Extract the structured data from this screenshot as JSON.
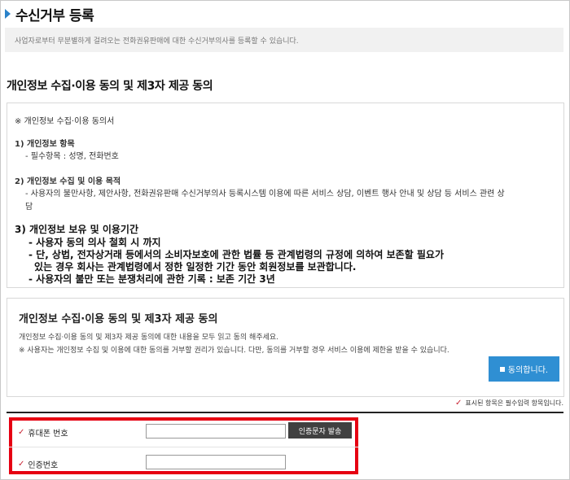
{
  "header": {
    "title": "수신거부 등록",
    "description": "사업자로부터 무분별하게 걸려오는 전화권유판매에 대한 수신거부의사를 등록할 수 있습니다."
  },
  "privacy_section": {
    "title": "개인정보 수집·이용 동의 및 제3자 제공 동의"
  },
  "terms": {
    "heading": "※ 개인정보 수집·이용 동의서",
    "item1_title": "1) 개인정보 항목",
    "item1_detail": "- 필수항목 : 성명, 전화번호",
    "item2_title": "2) 개인정보 수집 및 이용 목적",
    "item2_detail_line1": "- 사용자의 불만사항, 제안사항, 전화권유판매 수신거부의사 등록시스템 이용에 따른 서비스 상담, 이벤트 행사 안내 및 상담 등 서비스 관련 상",
    "item2_detail_line2": "담",
    "item3_title": "3) 개인정보 보유 및 이용기간",
    "item3_line1": "- 사용자 동의 의사 철회 시 까지",
    "item3_line2": "- 단, 상법, 전자상거래 등에서의 소비자보호에 관한 법률 등 관계법령의 규정에 의하여 보존할 필요가",
    "item3_line3": "있는 경우 회사는 관계법령에서 정한 일정한 기간 동안 회원정보를 보관합니다.",
    "item3_line4": "- 사용자의 불만 또는 분쟁처리에 관한 기록 : 보존 기간 3년"
  },
  "consent": {
    "title": "개인정보 수집·이용 동의 및 제3자 제공 동의",
    "line1": "개인정보 수집·이용 동의 및 제3자 제공 동의에 대한 내용을 모두 읽고 동의 해주세요.",
    "line2": "※ 사용자는 개인정보 수집 및 이용에 대한 동의를 거부할 권리가 있습니다. 다만, 동의를 거부할 경우 서비스 이용에 제한을 받을 수 있습니다.",
    "agree_label": "동의합니다."
  },
  "form": {
    "required_note": "표시된 항목은 필수입력 항목입니다.",
    "phone_label": "휴대폰 번호",
    "phone_value": "",
    "send_sms_label": "인증문자 발송",
    "code_label": "인증번호",
    "code_value": ""
  },
  "colors": {
    "accent": "#2f8fd3",
    "highlight_border": "#e60012",
    "required_mark": "#c82333"
  },
  "icons": {
    "title_marker": "triangle-right-icon",
    "required": "checkmark-icon",
    "agree": "square-icon"
  }
}
